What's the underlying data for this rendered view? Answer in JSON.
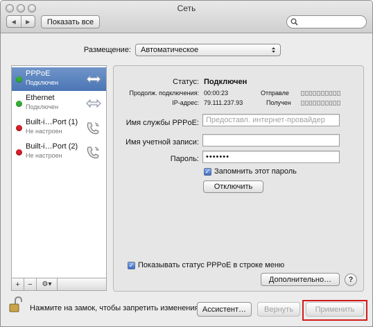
{
  "window": {
    "title": "Сеть"
  },
  "toolbar": {
    "back_icon": "◀",
    "forward_icon": "▶",
    "show_all_label": "Показать все",
    "search_placeholder": ""
  },
  "location": {
    "label": "Размещение:",
    "value": "Автоматическое"
  },
  "sidebar": {
    "services": [
      {
        "name": "PPPoE",
        "status": "Подключен",
        "status_color": "#34b233",
        "icon": "network-arrows-icon",
        "selected": true
      },
      {
        "name": "Ethernet",
        "status": "Подключен",
        "status_color": "#34b233",
        "icon": "network-arrows-icon",
        "selected": false
      },
      {
        "name": "Built-i…Port (1)",
        "status": "Не настроен",
        "status_color": "#d6202a",
        "icon": "phone-modem-icon",
        "selected": false
      },
      {
        "name": "Built-i…Port (2)",
        "status": "Не настроен",
        "status_color": "#d6202a",
        "icon": "phone-modem-icon",
        "selected": false
      }
    ],
    "add_label": "+",
    "remove_label": "−",
    "action_label": "⚙▾"
  },
  "details": {
    "status_label": "Статус:",
    "status_value": "Подключен",
    "duration_label": "Продолж. подключения:",
    "duration_value": "00:00:23",
    "ip_label": "IP-адрес:",
    "ip_value": "79.111.237.93",
    "sent_label": "Отправле",
    "received_label": "Получен",
    "service_name_label": "Имя службы PPPoE:",
    "service_name_placeholder": "Предоставл. интернет-провайдер",
    "account_label": "Имя учетной записи:",
    "account_value": "",
    "password_label": "Пароль:",
    "password_value": "•••••••",
    "remember_label": "Запомнить этот пароль",
    "remember_checked": true,
    "disconnect_label": "Отключить",
    "show_status_label": "Показывать статус PPPoE в строке меню",
    "show_status_checked": true,
    "advanced_label": "Дополнительно…",
    "help_label": "?"
  },
  "footer": {
    "lock_text": "Нажмите на замок, чтобы запретить изменения.",
    "assistant_label": "Ассистент…",
    "revert_label": "Вернуть",
    "apply_label": "Применить"
  },
  "colors": {
    "selection": "#4b76b5",
    "highlight_box": "#d21a1a"
  }
}
